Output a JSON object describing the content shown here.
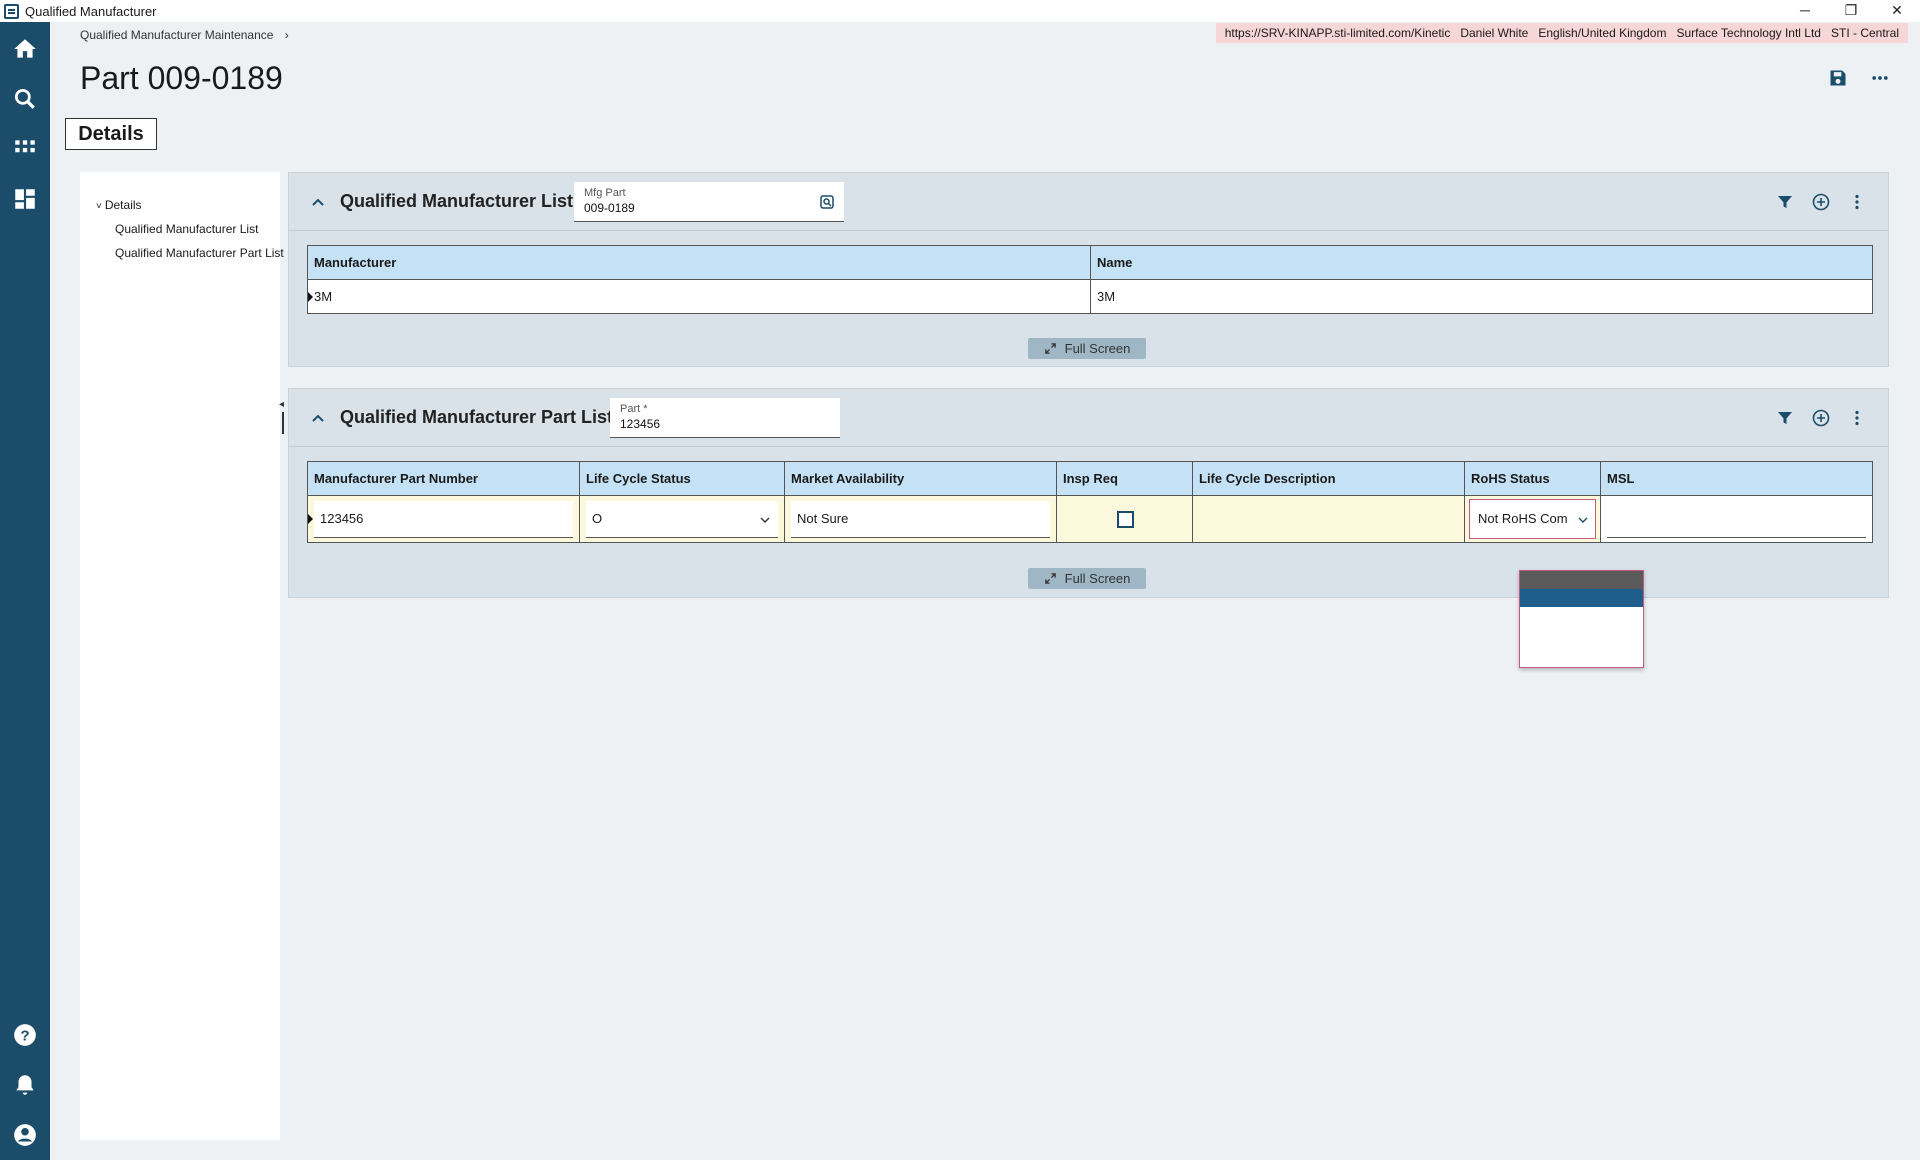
{
  "window": {
    "title": "Qualified Manufacturer",
    "controls": {
      "minimize": "─",
      "restore": "❐",
      "close": "✕"
    }
  },
  "rail": {
    "icons": [
      "home-icon",
      "search-icon",
      "apps-grid-icon",
      "dashboard-icon",
      "help-icon",
      "bell-icon",
      "account-icon"
    ]
  },
  "breadcrumb": {
    "item": "Qualified Manufacturer Maintenance",
    "separator": "›"
  },
  "infobar": {
    "url": "https://SRV-KINAPP.sti-limited.com/Kinetic",
    "user": "Daniel White",
    "language": "English/United Kingdom",
    "company": "Surface Technology Intl Ltd",
    "site": "STI - Central",
    "bg_color": "#f6d6d6"
  },
  "page": {
    "title": "Part 009-0189",
    "tab_label": "Details"
  },
  "tree": {
    "root": "Details",
    "expander": "˅",
    "children": [
      "Qualified Manufacturer List",
      "Qualified Manufacturer Part List"
    ]
  },
  "panel1": {
    "title": "Qualified Manufacturer List",
    "field": {
      "label": "Mfg Part",
      "value": "009-0189"
    },
    "columns": [
      "Manufacturer",
      "Name"
    ],
    "rows": [
      {
        "manufacturer": "3M",
        "name": "3M"
      }
    ],
    "full_screen_label": "Full Screen"
  },
  "panel2": {
    "title": "Qualified Manufacturer Part List",
    "field": {
      "label": "Part *",
      "value": "123456"
    },
    "columns": [
      "Manufacturer Part Number",
      "Life Cycle Status",
      "Market Availability",
      "Insp Req",
      "Life Cycle Description",
      "RoHS Status",
      "MSL"
    ],
    "row": {
      "mfg_part_number": "123456",
      "life_cycle_status": "O",
      "market_availability": "Not Sure",
      "insp_req": false,
      "life_cycle_description": "",
      "rohs_status": "Not RoHS Com",
      "msl": ""
    },
    "full_screen_label": "Full Screen"
  },
  "colors": {
    "rail": "#1b4d6b",
    "grid_header": "#c4e1f5",
    "edit_row": "#fbf8dc",
    "dropdown_highlight": "#1f5d8c",
    "dropdown_hover": "#5a5a5a",
    "focus_border": "#c35b7e"
  }
}
